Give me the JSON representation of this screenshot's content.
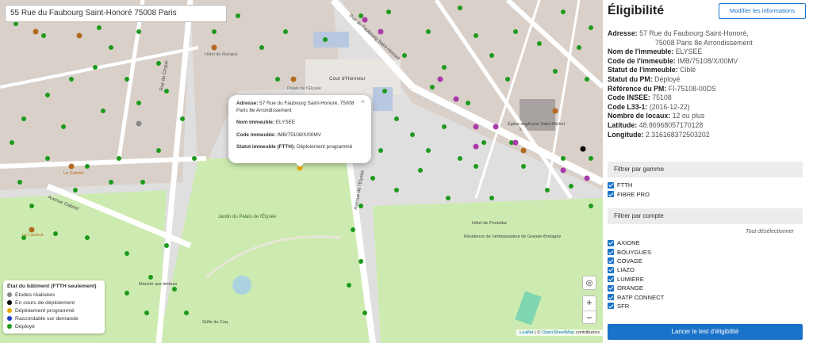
{
  "map": {
    "search_value": "55 Rue du Faubourg Saint-Honoré 75008 Paris",
    "popup": {
      "address_key": "Adresse:",
      "address_value": "57 Rue du Faubourg Saint-Honoré, 75008 Paris 8e Arrondissement",
      "name_key": "Nom immeuble:",
      "name_value": "ELYSEE",
      "code_key": "Code immeuble:",
      "code_value": "IMB/75108/X/00MV",
      "status_key": "Statut immeuble (FTTH):",
      "status_value": "Déploiement programmé",
      "close_glyph": "×"
    },
    "legend": {
      "title": "État du bâtiment (FTTH seulement)",
      "items": [
        {
          "label": "Etudes réalisées",
          "color": "#888888"
        },
        {
          "label": "En cours de déploiement",
          "color": "#000000"
        },
        {
          "label": "Déploiement programmé",
          "color": "#e8a800"
        },
        {
          "label": "Raccordable sur demande",
          "color": "#1a3cc9"
        },
        {
          "label": "Déployé",
          "color": "#1d9a1d"
        }
      ]
    },
    "controls": {
      "zoom_in": "+",
      "zoom_out": "−",
      "locate_glyph": "◎"
    },
    "attribution": {
      "leaflet": "Leaflet",
      "sep": " | © ",
      "osm": "OpenStreetMap",
      "rest": " contributors"
    },
    "labels": {
      "cour": "Cour d'Honneur",
      "palais": "Palais de l'Élysée",
      "jardin": "Jardin du Palais de l'Élysée",
      "avenue_gabriel": "Avenue Gabriel",
      "avenue_elysee": "Avenue de l'Élysée",
      "hotel_marigny": "Hôtel de Marigny",
      "rue_cirque": "Rue du Cirque",
      "rue_faubourg": "Rue du Faubourg Saint-Honoré",
      "eglise": "Église anglicane Saint-Michel",
      "le_gabriel": "Le Gabriel",
      "la_laurent": "Le Laurent",
      "grille_coq": "Grille du Coq",
      "residence": "Résidence de l'ambassadeur de Grande-Bretagne",
      "hotel_pontalba": "Hôtel de Pontalba",
      "marche": "Marché aux timbres"
    },
    "colors": {
      "deployed": "#1d9a1d",
      "programmed": "#e8a800",
      "studies": "#888888",
      "in_progress": "#000000",
      "shop": "#a93aa9"
    }
  },
  "panel": {
    "title": "Éligibilité",
    "modify_button": "Modifier les informations",
    "info": [
      {
        "key": "Adresse:",
        "value": "57 Rue du Faubourg Saint-Honoré,"
      },
      {
        "key": "",
        "value": "75008 Paris 8e Arrondissement"
      },
      {
        "key": "Nom de l'immeuble:",
        "value": "ELYSEE"
      },
      {
        "key": "Code de l'immeuble:",
        "value": "IMB/75108/X/00MV"
      },
      {
        "key": "Statut de l'immeuble:",
        "value": "Ciblé"
      },
      {
        "key": "Statut du PM:",
        "value": "Déployé"
      },
      {
        "key": "Référence du PM:",
        "value": "FI-75108-00DS"
      },
      {
        "key": "Code INSEE:",
        "value": "75108"
      },
      {
        "key": "Code L33-1:",
        "value": "(2016-12-22)"
      },
      {
        "key": "Nombre de locaux:",
        "value": "12 ou plus"
      },
      {
        "key": "Latitude:",
        "value": "48.86968057170128"
      },
      {
        "key": "Longitude:",
        "value": "2.316168372503202"
      }
    ],
    "gamme_header": "Filtrer par gamme",
    "gamme": [
      {
        "label": "FTTH",
        "checked": true
      },
      {
        "label": "FIBRE PRO",
        "checked": true
      }
    ],
    "compte_header": "Filtrer par compte",
    "deselect_all": "Tout désélectionner",
    "comptes": [
      {
        "label": "AXIONE",
        "checked": true
      },
      {
        "label": "BOUYGUES",
        "checked": true
      },
      {
        "label": "COVAGE",
        "checked": true
      },
      {
        "label": "LIAZO",
        "checked": true
      },
      {
        "label": "LUMIERE",
        "checked": true
      },
      {
        "label": "ORANGE",
        "checked": true
      },
      {
        "label": "RATP CONNECT",
        "checked": true
      },
      {
        "label": "SFR",
        "checked": true
      }
    ],
    "launch_button": "Lancer le test d'éligibilité"
  }
}
